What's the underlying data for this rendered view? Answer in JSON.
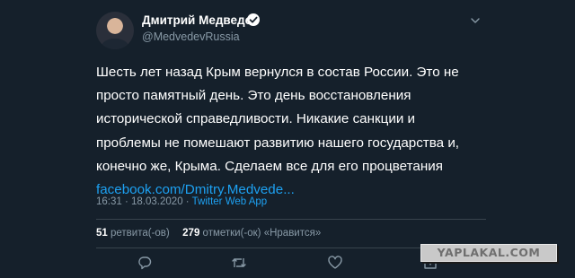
{
  "tweet": {
    "author_name": "Дмитрий Медведев",
    "author_handle": "@MedvedevRussia",
    "text_lines": [
      "Шесть лет назад Крым вернулся в состав России. Это не",
      "просто памятный день. Это день восстановления",
      "исторической справедливости. Никакие санкции и",
      "проблемы не помешают развитию нашего государства и,",
      "конечно же, Крыма. Сделаем все для его процветания"
    ],
    "link_text": "facebook.com/Dmitry.Medvede...",
    "time": "16:31",
    "separator": "·",
    "date": "18.03.2020",
    "source": "Twitter Web App"
  },
  "stats": {
    "retweets_count": "51",
    "retweets_label": "ретвита(-ов)",
    "likes_count": "279",
    "likes_label": "отметки(-ок) «Нравится»"
  },
  "icons": {
    "verified": "verified-badge-icon",
    "more": "chevron-down-icon",
    "reply": "reply-icon",
    "retweet": "retweet-icon",
    "like": "heart-icon",
    "share": "share-icon"
  },
  "watermark": {
    "text": "YAPLAKAL.COM"
  },
  "colors": {
    "background": "#15202b",
    "text": "#ffffff",
    "secondary": "#8899a6",
    "accent": "#1da1f2",
    "divider": "#38444d"
  }
}
